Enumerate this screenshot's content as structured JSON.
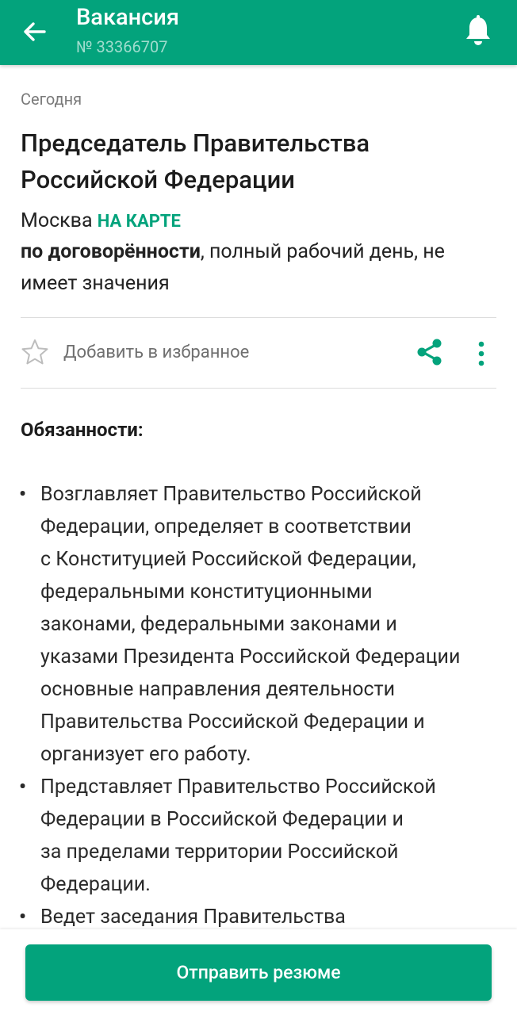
{
  "colors": {
    "brand": "#03a37c",
    "text_primary": "#1c1c1c",
    "text_secondary": "#7a7a7a",
    "divider": "#dcdcdc"
  },
  "header": {
    "title": "Вакансия",
    "subtitle": "№ 33366707",
    "back_icon": "arrow-left-icon",
    "notification_icon": "bell-icon"
  },
  "vacancy": {
    "date": "Сегодня",
    "title": "Председатель Правительства Российской Федерации",
    "city": "Москва",
    "map_link": "НА КАРТЕ",
    "salary": "по договорённости",
    "conditions": ", полный рабочий день, не имеет значения"
  },
  "actions": {
    "favorite_label": "Добавить в избранное",
    "favorite_icon": "star-outline-icon",
    "share_icon": "share-icon",
    "more_icon": "more-vertical-icon"
  },
  "duties": {
    "header": "Обязанности:",
    "bullet": "•",
    "items": [
      "Возглавляет Правительство Российской\nФедерации, определяет в соответствии\nс Конституцией Российской Федерации,\nфедеральными конституционными\nзаконами, федеральными законами и\nуказами Президента Российской Федерации\nосновные направления деятельности\nПравительства Российской Федерации и\nорганизует его работу.",
      "Представляет Правительство Российской\nФедерации в Российской Федерации и\nза пределами территории Российской\nФедерации.",
      "Ведет заседания Правительства"
    ]
  },
  "footer": {
    "send_label": "Отправить резюме"
  }
}
